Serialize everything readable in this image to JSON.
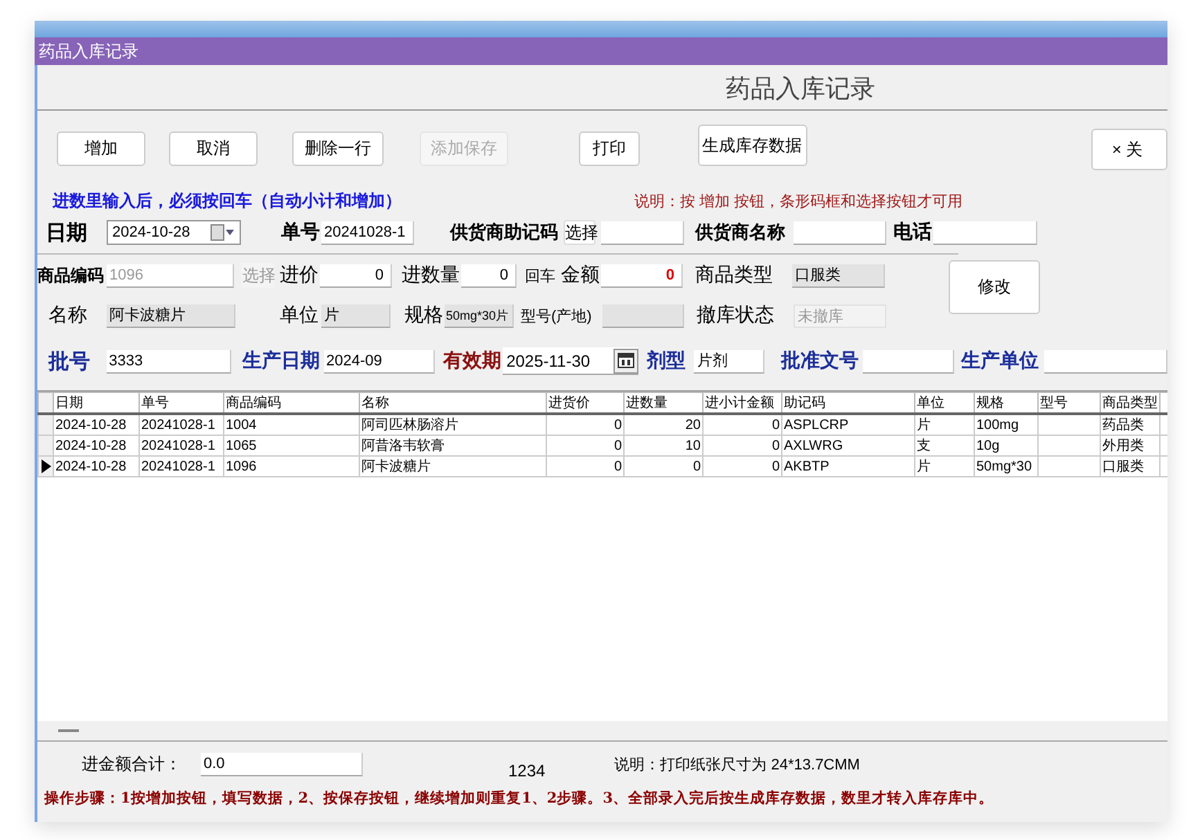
{
  "window": {
    "title": "药品入库记录"
  },
  "heading": "药品入库记录",
  "buttons": [
    {
      "label": "增加",
      "disabled": false
    },
    {
      "label": "取消",
      "disabled": false
    },
    {
      "label": "删除一行",
      "disabled": false
    },
    {
      "label": "添加保存",
      "disabled": true
    },
    {
      "label": "打印",
      "disabled": false
    },
    {
      "label": "生成库存数据",
      "disabled": false
    },
    {
      "label": "× 关",
      "disabled": false
    }
  ],
  "input_hint": "进数里输入后，必须按回车（自动小计和增加）",
  "button_hint": "说明：按 增加 按钮，条形码框和选择按钮才可用",
  "supplier": {
    "date_label": "日期",
    "date": "2024-10-28",
    "order_no_label": "单号",
    "order_no": "20241028-1",
    "code_label": "供货商助记码",
    "select_button": {
      "label": "选择",
      "disabled": false
    },
    "name_label": "供货商名称",
    "phone_label": "电话"
  },
  "product": {
    "code_label": "商品编码",
    "code": "1096",
    "select_button": {
      "label": "选择",
      "disabled": true
    },
    "price_label": "进价",
    "price": "0",
    "quantity_label": "进数量",
    "quantity": "0",
    "enter_note": "回车",
    "amount_label": "金额",
    "amount": "0",
    "type_label": "商品类型",
    "type": "口服类",
    "name_label": "名称",
    "name": "阿卡波糖片",
    "unit_label": "单位",
    "unit": "片",
    "spec_label": "规格",
    "spec": "50mg*30片",
    "model_label": "型号(产地)",
    "withdraw_label": "撤库状态",
    "withdraw": "未撤库",
    "edit_button": "修改"
  },
  "batch": {
    "batch_label": "批号",
    "batch": "3333",
    "production_date_label": "生产日期",
    "production_date": "2024-09",
    "expiry_label": "有效期",
    "expiry": "2025-11-30",
    "form_label": "剂型",
    "form": "片剂",
    "approval_label": "批准文号",
    "maker_label": "生产单位"
  },
  "table": {
    "columns": [
      {
        "label": "日期",
        "kind": "text"
      },
      {
        "label": "单号",
        "kind": "text"
      },
      {
        "label": "商品编码",
        "kind": "text"
      },
      {
        "label": "名称",
        "kind": "text"
      },
      {
        "label": "进货价",
        "kind": "number"
      },
      {
        "label": "进数量",
        "kind": "number"
      },
      {
        "label": "进小计金额",
        "kind": "number"
      },
      {
        "label": "助记码",
        "kind": "text"
      },
      {
        "label": "单位",
        "kind": "text"
      },
      {
        "label": "规格",
        "kind": "text"
      },
      {
        "label": "型号",
        "kind": "text"
      },
      {
        "label": "商品类型",
        "kind": "text"
      }
    ],
    "rows": [
      {
        "selected": false,
        "cells": [
          "2024-10-28",
          "20241028-1",
          "1004",
          "阿司匹林肠溶片",
          "0",
          "20",
          "0",
          "ASPLCRP",
          "片",
          "100mg",
          "",
          "药品类"
        ]
      },
      {
        "selected": false,
        "cells": [
          "2024-10-28",
          "20241028-1",
          "1065",
          "阿昔洛韦软膏",
          "0",
          "10",
          "0",
          "AXLWRG",
          "支",
          "10g",
          "",
          "外用类"
        ]
      },
      {
        "selected": true,
        "cells": [
          "2024-10-28",
          "20241028-1",
          "1096",
          "阿卡波糖片",
          "0",
          "0",
          "0",
          "AKBTP",
          "片",
          "50mg*30",
          "",
          "口服类"
        ]
      }
    ]
  },
  "total_label": "进金额合计：",
  "total": "0.0",
  "code_text": "1234",
  "print_note": "说明：打印纸张尺寸为 24*13.7CMM",
  "steps": "操作步骤：1按增加按钮，填写数据，2、按保存按钮，继续增加则重复1、2步骤。3、全部录入完后按生成库存数据，数里才转入库存库中。"
}
